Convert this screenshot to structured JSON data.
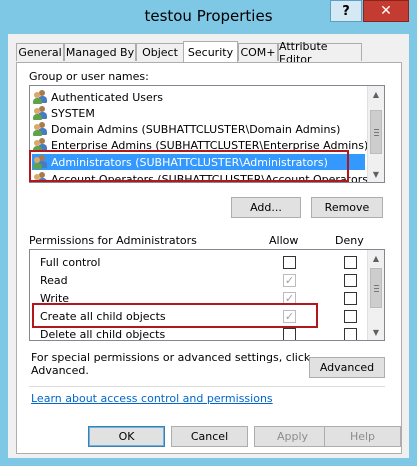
{
  "window": {
    "title": "testou Properties",
    "help_label": "?",
    "close_label": "✕"
  },
  "tabs": [
    {
      "label": "General"
    },
    {
      "label": "Managed By"
    },
    {
      "label": "Object"
    },
    {
      "label": "Security"
    },
    {
      "label": "COM+"
    },
    {
      "label": "Attribute Editor"
    }
  ],
  "groups": {
    "heading": "Group or user names:",
    "items": [
      {
        "name": "Authenticated Users"
      },
      {
        "name": "SYSTEM"
      },
      {
        "name": "Domain Admins (SUBHATTCLUSTER\\Domain Admins)"
      },
      {
        "name": "Enterprise Admins (SUBHATTCLUSTER\\Enterprise Admins)"
      },
      {
        "name": "Administrators (SUBHATTCLUSTER\\Administrators)"
      },
      {
        "name": "Account Operators (SUBHATTCLUSTER\\Account Operators)"
      }
    ],
    "add_label": "Add...",
    "remove_label": "Remove"
  },
  "permissions": {
    "heading": "Permissions for Administrators",
    "allow_label": "Allow",
    "deny_label": "Deny",
    "items": [
      {
        "name": "Full control",
        "allow": "",
        "deny": ""
      },
      {
        "name": "Read",
        "allow": "✓",
        "deny": ""
      },
      {
        "name": "Write",
        "allow": "✓",
        "deny": ""
      },
      {
        "name": "Create all child objects",
        "allow": "✓",
        "deny": ""
      },
      {
        "name": "Delete all child objects",
        "allow": "",
        "deny": ""
      }
    ]
  },
  "advanced": {
    "text_line1": "For special permissions or advanced settings, click",
    "text_line2": "Advanced.",
    "button_label": "Advanced"
  },
  "learn_link": "Learn about access control and permissions",
  "footer": {
    "ok_label": "OK",
    "cancel_label": "Cancel",
    "apply_label": "Apply",
    "help_label": "Help"
  },
  "colors": {
    "selection": "#3399ff",
    "highlight_box": "#b0181e",
    "title_bar": "#7ec8e6",
    "close_button": "#c43c31"
  }
}
